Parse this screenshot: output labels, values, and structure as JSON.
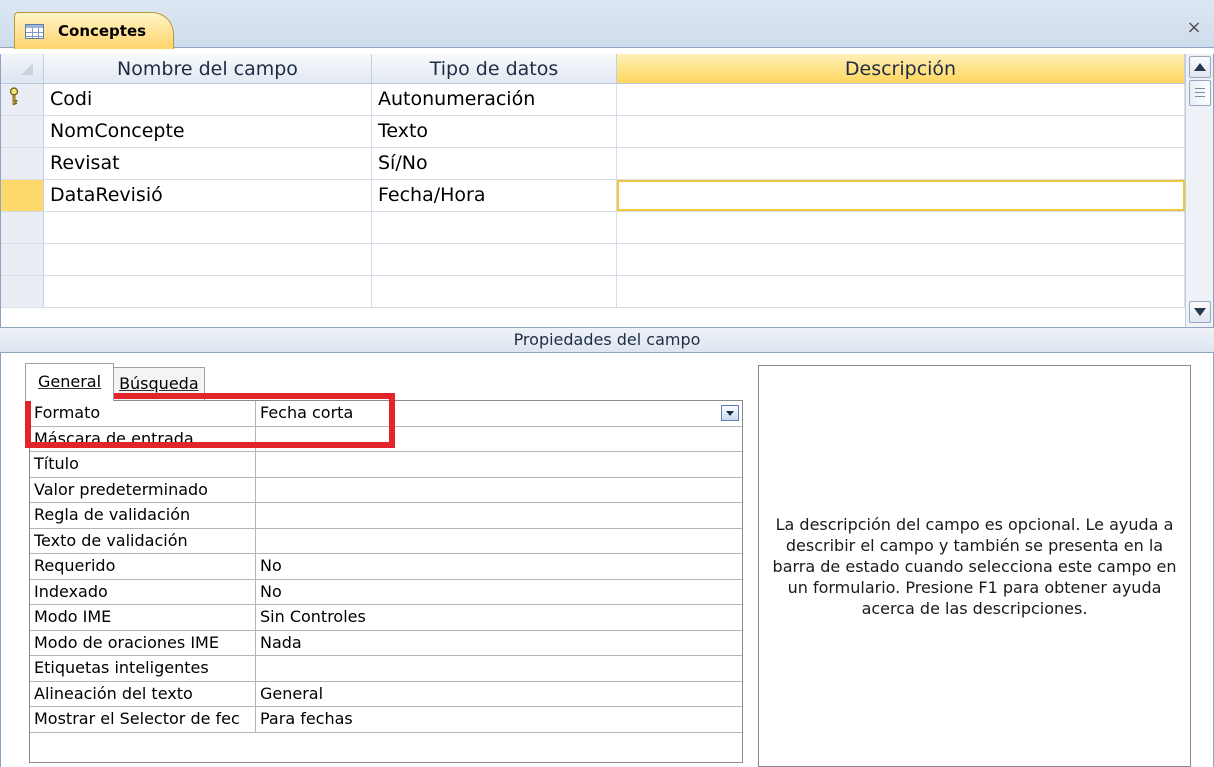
{
  "tab": {
    "title": "Conceptes",
    "close_label": "×"
  },
  "grid": {
    "columns": [
      "Nombre del campo",
      "Tipo de datos",
      "Descripción"
    ],
    "rows": [
      {
        "name": "Codi",
        "type": "Autonumeración",
        "desc": ""
      },
      {
        "name": "NomConcepte",
        "type": "Texto",
        "desc": ""
      },
      {
        "name": "Revisat",
        "type": "Sí/No",
        "desc": ""
      },
      {
        "name": "DataRevisió",
        "type": "Fecha/Hora",
        "desc": ""
      }
    ]
  },
  "props": {
    "header": "Propiedades del campo",
    "tabs": [
      "General",
      "Búsqueda"
    ],
    "items": [
      {
        "name": "Formato",
        "value": "Fecha corta"
      },
      {
        "name": "Máscara de entrada",
        "value": ""
      },
      {
        "name": "Título",
        "value": ""
      },
      {
        "name": "Valor predeterminado",
        "value": ""
      },
      {
        "name": "Regla de validación",
        "value": ""
      },
      {
        "name": "Texto de validación",
        "value": ""
      },
      {
        "name": "Requerido",
        "value": "No"
      },
      {
        "name": "Indexado",
        "value": "No"
      },
      {
        "name": "Modo IME",
        "value": "Sin Controles"
      },
      {
        "name": "Modo de oraciones IME",
        "value": "Nada"
      },
      {
        "name": "Etiquetas inteligentes",
        "value": ""
      },
      {
        "name": "Alineación del texto",
        "value": "General"
      },
      {
        "name": "Mostrar el Selector de fec",
        "value": "Para fechas"
      }
    ],
    "help_text": "La descripción del campo es opcional. Le ayuda a describir el campo y también se presenta en la barra de estado cuando selecciona este campo en un formulario. Presione F1 para obtener ayuda acerca de las descripciones."
  },
  "icons": {
    "table": "table-icon",
    "key": "primary-key-icon",
    "close": "close-icon",
    "dropdown": "chevron-down-icon"
  },
  "colors": {
    "accent": "#ffd46b",
    "highlight": "#e2242b",
    "chrome": "#cfdcec"
  }
}
